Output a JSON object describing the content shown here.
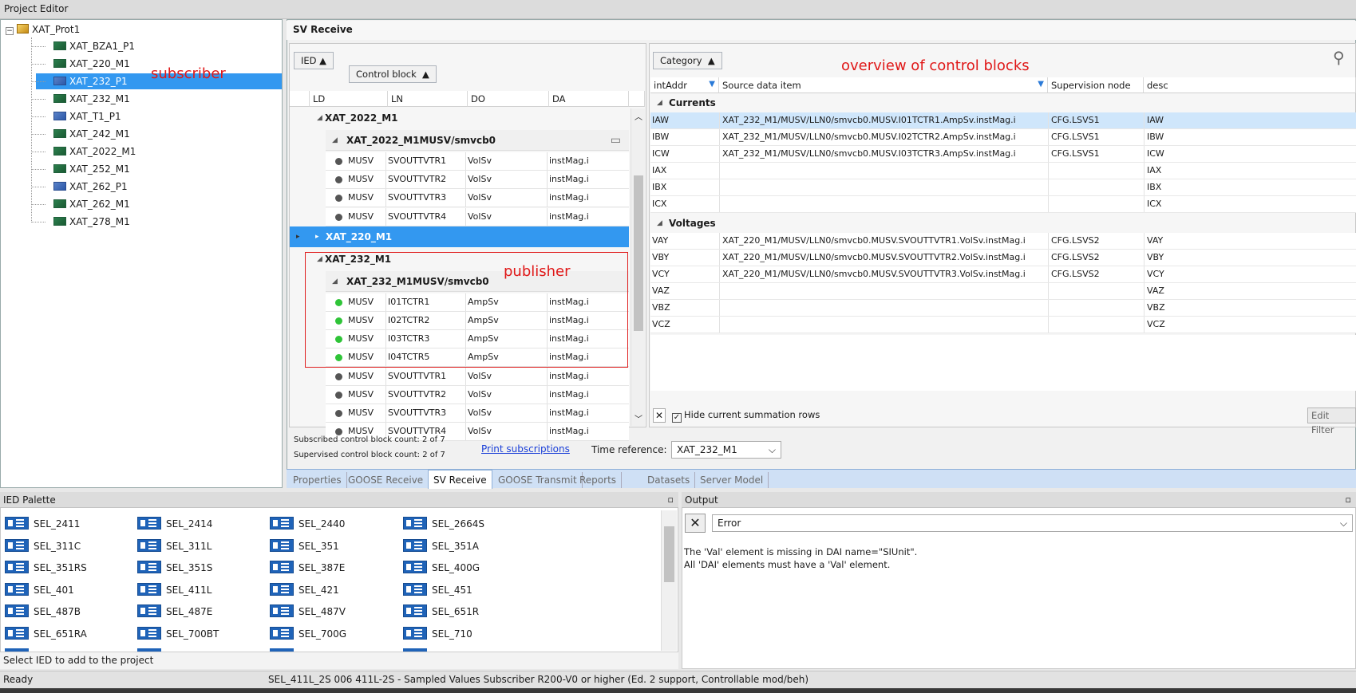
{
  "window_title": "Project Editor",
  "tree": {
    "root": "XAT_Prot1",
    "items": [
      {
        "label": "XAT_BZA1_P1",
        "icon": "green"
      },
      {
        "label": "XAT_220_M1",
        "icon": "green"
      },
      {
        "label": "XAT_232_P1",
        "icon": "blue",
        "selected": true
      },
      {
        "label": "XAT_232_M1",
        "icon": "green"
      },
      {
        "label": "XAT_T1_P1",
        "icon": "blue"
      },
      {
        "label": "XAT_242_M1",
        "icon": "green"
      },
      {
        "label": "XAT_2022_M1",
        "icon": "green"
      },
      {
        "label": "XAT_252_M1",
        "icon": "green"
      },
      {
        "label": "XAT_262_P1",
        "icon": "blue"
      },
      {
        "label": "XAT_262_M1",
        "icon": "green"
      },
      {
        "label": "XAT_278_M1",
        "icon": "green"
      }
    ],
    "annotation": "subscriber"
  },
  "sv": {
    "title": "SV Receive",
    "group_chips": [
      "IED",
      "Control block"
    ],
    "columns": [
      "LD",
      "LN",
      "DO",
      "DA"
    ],
    "groups": [
      {
        "name": "XAT_2022_M1",
        "sub": "XAT_2022_M1MUSV/smvcb0",
        "rows": [
          [
            "MUSV",
            "SVOUTTVTR1",
            "VolSv",
            "instMag.i"
          ],
          [
            "MUSV",
            "SVOUTTVTR2",
            "VolSv",
            "instMag.i"
          ],
          [
            "MUSV",
            "SVOUTTVTR3",
            "VolSv",
            "instMag.i"
          ],
          [
            "MUSV",
            "SVOUTTVTR4",
            "VolSv",
            "instMag.i"
          ]
        ]
      },
      {
        "name": "XAT_220_M1"
      },
      {
        "name": "XAT_232_M1",
        "sub": "XAT_232_M1MUSV/smvcb0",
        "rows": [
          [
            "MUSV",
            "I01TCTR1",
            "AmpSv",
            "instMag.i"
          ],
          [
            "MUSV",
            "I02TCTR2",
            "AmpSv",
            "instMag.i"
          ],
          [
            "MUSV",
            "I03TCTR3",
            "AmpSv",
            "instMag.i"
          ],
          [
            "MUSV",
            "I04TCTR5",
            "AmpSv",
            "instMag.i"
          ],
          [
            "MUSV",
            "SVOUTTVTR1",
            "VolSv",
            "instMag.i"
          ],
          [
            "MUSV",
            "SVOUTTVTR2",
            "VolSv",
            "instMag.i"
          ],
          [
            "MUSV",
            "SVOUTTVTR3",
            "VolSv",
            "instMag.i"
          ],
          [
            "MUSV",
            "SVOUTTVTR4",
            "VolSv",
            "instMag.i"
          ]
        ]
      }
    ],
    "publisher_annotation": "publisher",
    "overview_annotation": "overview of control blocks",
    "right_chip": "Category",
    "right_columns": [
      "intAddr",
      "Source data item",
      "Supervision node",
      "desc"
    ],
    "categories": [
      {
        "name": "Currents",
        "rows": [
          [
            "IAW",
            "XAT_232_M1/MUSV/LLN0/smvcb0.MUSV.I01TCTR1.AmpSv.instMag.i",
            "CFG.LSVS1",
            "IAW"
          ],
          [
            "IBW",
            "XAT_232_M1/MUSV/LLN0/smvcb0.MUSV.I02TCTR2.AmpSv.instMag.i",
            "CFG.LSVS1",
            "IBW"
          ],
          [
            "ICW",
            "XAT_232_M1/MUSV/LLN0/smvcb0.MUSV.I03TCTR3.AmpSv.instMag.i",
            "CFG.LSVS1",
            "ICW"
          ],
          [
            "IAX",
            "",
            "",
            "IAX"
          ],
          [
            "IBX",
            "",
            "",
            "IBX"
          ],
          [
            "ICX",
            "",
            "",
            "ICX"
          ]
        ]
      },
      {
        "name": "Voltages",
        "rows": [
          [
            "VAY",
            "XAT_220_M1/MUSV/LLN0/smvcb0.MUSV.SVOUTTVTR1.VolSv.instMag.i",
            "CFG.LSVS2",
            "VAY"
          ],
          [
            "VBY",
            "XAT_220_M1/MUSV/LLN0/smvcb0.MUSV.SVOUTTVTR2.VolSv.instMag.i",
            "CFG.LSVS2",
            "VBY"
          ],
          [
            "VCY",
            "XAT_220_M1/MUSV/LLN0/smvcb0.MUSV.SVOUTTVTR3.VolSv.instMag.i",
            "CFG.LSVS2",
            "VCY"
          ],
          [
            "VAZ",
            "",
            "",
            "VAZ"
          ],
          [
            "VBZ",
            "",
            "",
            "VBZ"
          ],
          [
            "VCZ",
            "",
            "",
            "VCZ"
          ]
        ]
      }
    ],
    "hide_rows_label": "Hide current summation rows",
    "edit_filter_label": "Edit Filter",
    "subscribed_count": "Subscribed control block count:  2  of 7",
    "supervised_count": "Supervised control block count:  2  of 7",
    "print_link": "Print subscriptions",
    "time_ref_label": "Time reference:",
    "time_ref_value": "XAT_232_M1"
  },
  "tabs": [
    "Properties",
    "GOOSE Receive",
    "SV Receive",
    "GOOSE Transmit",
    "Reports",
    "Datasets",
    "Server Model"
  ],
  "active_tab": "SV Receive",
  "palette": {
    "title": "IED Palette",
    "items": [
      "SEL_2411",
      "SEL_2414",
      "SEL_2440",
      "SEL_2664S",
      "SEL_311C",
      "SEL_311L",
      "SEL_351",
      "SEL_351A",
      "SEL_351RS",
      "SEL_351S",
      "SEL_387E",
      "SEL_400G",
      "SEL_401",
      "SEL_411L",
      "SEL_421",
      "SEL_451",
      "SEL_487B",
      "SEL_487E",
      "SEL_487V",
      "SEL_651R",
      "SEL_651RA",
      "SEL_700BT",
      "SEL_700G",
      "SEL_710"
    ],
    "hint": "Select  IED to add to the project"
  },
  "output": {
    "title": "Output",
    "filter": "Error",
    "lines": [
      "The 'Val' element is missing in DAI name=\"SIUnit\".",
      "All 'DAI' elements must have a 'Val' element."
    ]
  },
  "status": {
    "left": "Ready",
    "right": "SEL_411L_2S  006  411L-2S - Sampled Values Subscriber R200-V0 or higher (Ed. 2 support, Controllable mod/beh)"
  }
}
